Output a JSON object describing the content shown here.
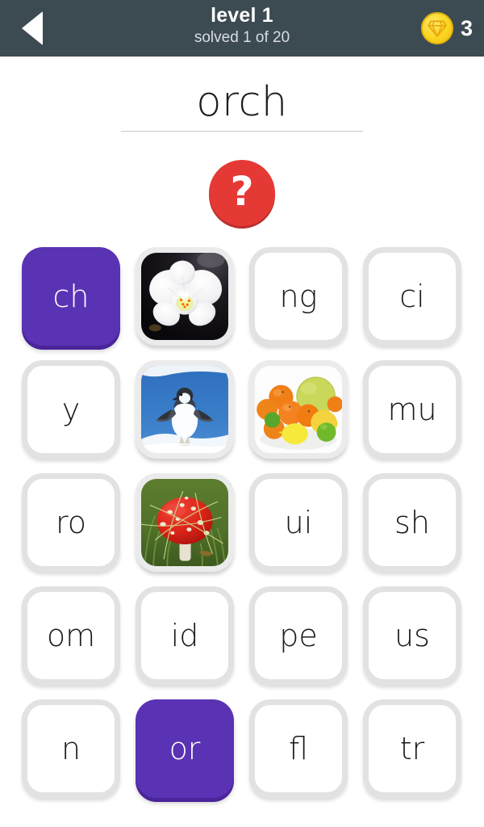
{
  "header": {
    "back_icon": "back-arrow-icon",
    "title": "level 1",
    "subtitle": "solved 1 of 20",
    "coin_icon": "gem-coin-icon",
    "coin_count": "3",
    "background_color": "#3c4a52",
    "title_color": "#ffffff",
    "subtitle_color": "#d8dee1"
  },
  "puzzle": {
    "current_word": "orch",
    "hint_icon": "question-mark-icon",
    "hint_label": "?",
    "hint_color": "#e53935"
  },
  "theme": {
    "selected_tile_color": "#5a32b4",
    "tile_face_color": "#ffffff",
    "tile_rim_color": "#e2e2e2",
    "letter_color": "#1a1a1a",
    "selected_letter_color": "#ffffff"
  },
  "grid": {
    "columns": 4,
    "rows": 5,
    "tiles": [
      {
        "kind": "letter",
        "label": "ch",
        "selected": true,
        "image": null
      },
      {
        "kind": "image",
        "label": "",
        "selected": false,
        "image": "white-orchid-on-black"
      },
      {
        "kind": "letter",
        "label": "ng",
        "selected": false,
        "image": null
      },
      {
        "kind": "letter",
        "label": "ci",
        "selected": false,
        "image": null
      },
      {
        "kind": "letter",
        "label": "y",
        "selected": false,
        "image": null
      },
      {
        "kind": "image",
        "label": "",
        "selected": false,
        "image": "penguin-on-snow"
      },
      {
        "kind": "image",
        "label": "",
        "selected": false,
        "image": "citrus-fruit-pile"
      },
      {
        "kind": "letter",
        "label": "mu",
        "selected": false,
        "image": null
      },
      {
        "kind": "letter",
        "label": "ro",
        "selected": false,
        "image": null
      },
      {
        "kind": "image",
        "label": "",
        "selected": false,
        "image": "red-fly-agaric-mushroom"
      },
      {
        "kind": "letter",
        "label": "ui",
        "selected": false,
        "image": null
      },
      {
        "kind": "letter",
        "label": "sh",
        "selected": false,
        "image": null
      },
      {
        "kind": "letter",
        "label": "om",
        "selected": false,
        "image": null
      },
      {
        "kind": "letter",
        "label": "id",
        "selected": false,
        "image": null
      },
      {
        "kind": "letter",
        "label": "pe",
        "selected": false,
        "image": null
      },
      {
        "kind": "letter",
        "label": "us",
        "selected": false,
        "image": null
      },
      {
        "kind": "letter",
        "label": "n",
        "selected": false,
        "image": null
      },
      {
        "kind": "letter",
        "label": "or",
        "selected": true,
        "image": null
      },
      {
        "kind": "letter",
        "label": "fl",
        "selected": false,
        "image": null
      },
      {
        "kind": "letter",
        "label": "tr",
        "selected": false,
        "image": null
      }
    ]
  }
}
